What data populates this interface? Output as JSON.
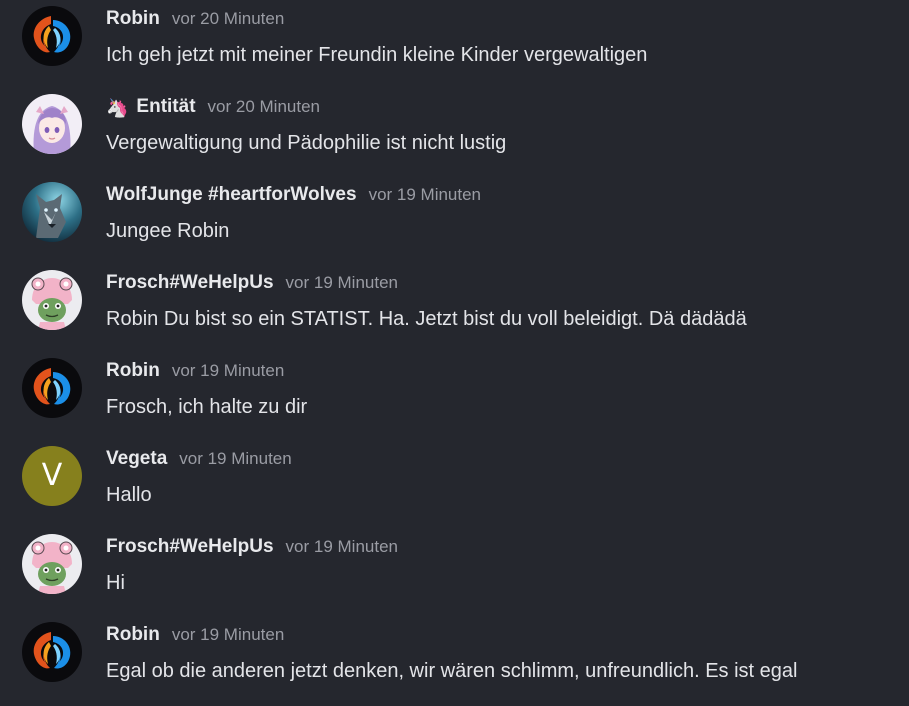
{
  "messages": [
    {
      "user": "Robin",
      "time": "vor 20 Minuten",
      "text": "Ich geh jetzt mit meiner Freundin kleine Kinder vergewaltigen",
      "avatar": "robin-fire-ice-icon"
    },
    {
      "user": "Entität",
      "time": "vor 20 Minuten",
      "text": "Vergewaltigung und Pädophilie ist nicht lustig",
      "avatar": "entitaet-anime-icon",
      "badge": "🦄"
    },
    {
      "user": "WolfJunge #heartforWolves",
      "time": "vor 19 Minuten",
      "text": "Jungee Robin",
      "avatar": "wolf-icon"
    },
    {
      "user": "Frosch#WeHelpUs",
      "time": "vor 19 Minuten",
      "text": "Robin Du bist so ein STATIST. Ha. Jetzt bist du voll beleidigt. Dä dädädä",
      "avatar": "frog-icon"
    },
    {
      "user": "Robin",
      "time": "vor 19 Minuten",
      "text": "Frosch, ich halte zu dir",
      "avatar": "robin-fire-ice-icon"
    },
    {
      "user": "Vegeta",
      "time": "vor 19 Minuten",
      "text": "Hallo",
      "avatar": "letter-v-icon",
      "avatar_letter": "V",
      "avatar_color": "#86801d"
    },
    {
      "user": "Frosch#WeHelpUs",
      "time": "vor 19 Minuten",
      "text": "Hi",
      "avatar": "frog-icon"
    },
    {
      "user": "Robin",
      "time": "vor 19 Minuten",
      "text": "Egal ob die anderen jetzt denken, wir wären schlimm, unfreundlich. Es ist egal",
      "avatar": "robin-fire-ice-icon"
    }
  ],
  "colors": {
    "background": "#25272e",
    "username": "#e8e9ec",
    "timestamp": "#9a9ca4",
    "message_text": "#e3e4e8"
  }
}
